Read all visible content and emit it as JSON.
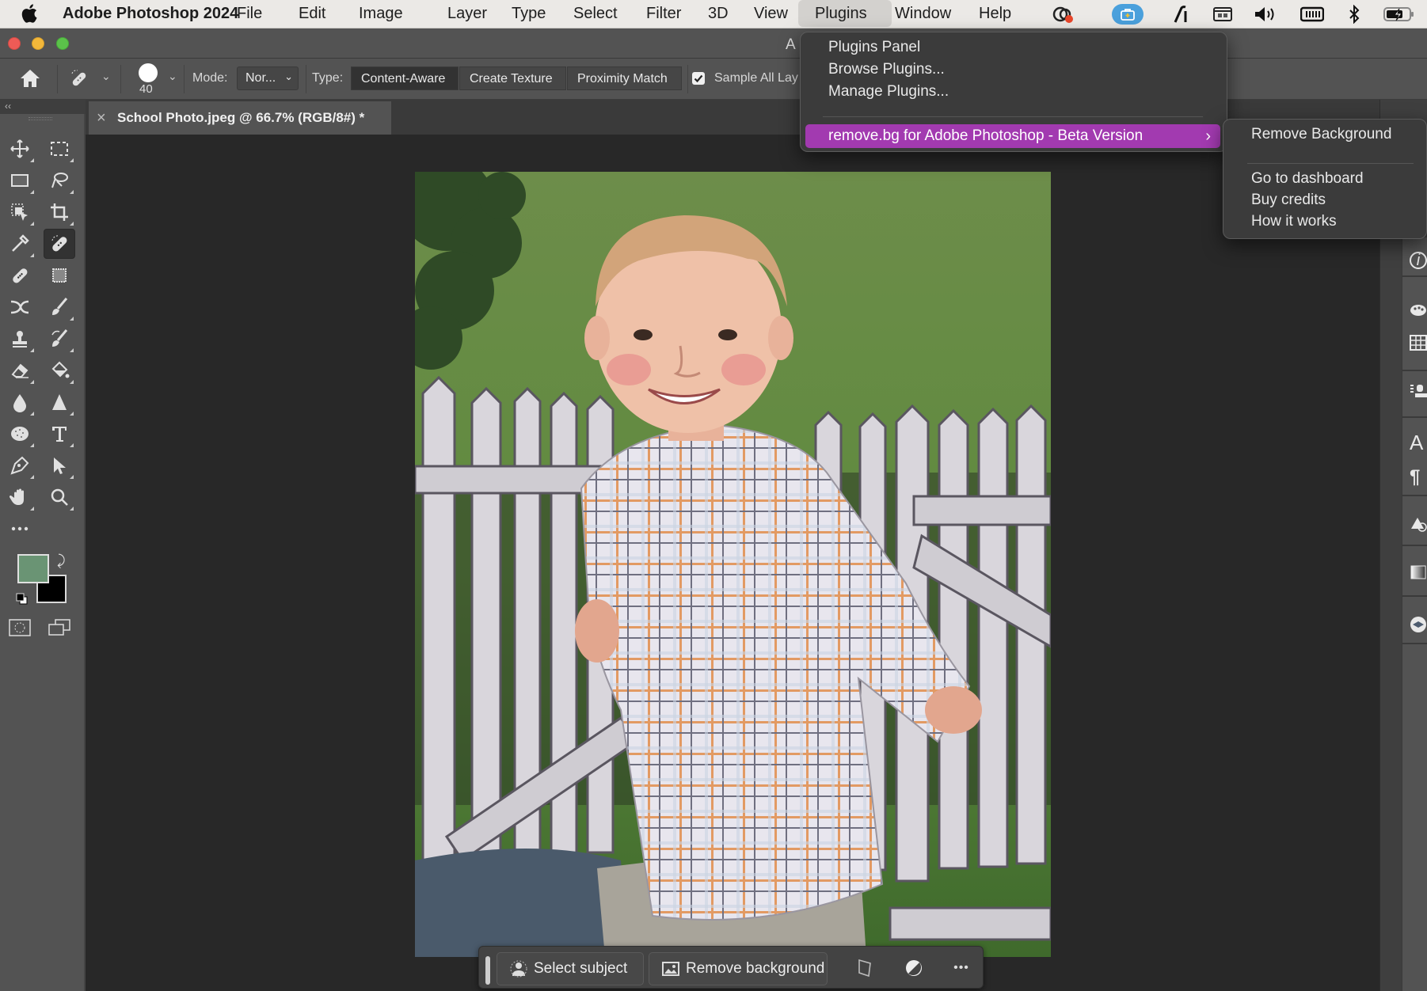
{
  "menubar": {
    "app_name": "Adobe Photoshop 2024",
    "items": [
      "File",
      "Edit",
      "Image",
      "Layer",
      "Type",
      "Select",
      "Filter",
      "3D",
      "View",
      "Plugins",
      "Window",
      "Help"
    ],
    "active_item": "Plugins",
    "tray_icons": [
      "creative-cloud-icon",
      "toolbox-app-icon",
      "pen-app-icon",
      "screen-capture-icon",
      "volume-icon",
      "keyboard-icon",
      "bluetooth-icon",
      "battery-charging-icon"
    ]
  },
  "window": {
    "title_partial": "A"
  },
  "options_bar": {
    "brush_size": "40",
    "mode_label": "Mode:",
    "mode_value": "Nor...",
    "type_label": "Type:",
    "type_options": [
      "Content-Aware",
      "Create Texture",
      "Proximity Match"
    ],
    "type_selected": "Content-Aware",
    "sample_all_layers_label": "Sample All Lay",
    "sample_all_layers_checked": true
  },
  "document_tab": {
    "title": "School Photo.jpeg @ 66.7% (RGB/8#) *",
    "close_glyph": "×"
  },
  "toolbar": {
    "collapse_glyph": "‹‹",
    "tools": [
      "move",
      "marquee",
      "object-frame",
      "lasso",
      "object-selection",
      "crop",
      "eyedropper",
      "spot-healing-brush",
      "healing-brush",
      "patch",
      "content-aware-move",
      "brush",
      "clone-stamp",
      "history-brush",
      "eraser",
      "paint-bucket",
      "blur",
      "sharpen",
      "sponge",
      "type",
      "pen",
      "path-selection",
      "hand",
      "zoom",
      "more-tools"
    ],
    "selected_tool": "spot-healing-brush",
    "more_glyph": "•••",
    "foreground_color": "#6a9474",
    "background_color": "#000000"
  },
  "plugins_menu": {
    "items": [
      "Plugins Panel",
      "Browse Plugins...",
      "Manage Plugins..."
    ],
    "highlighted": "remove.bg for Adobe Photoshop - Beta Version",
    "highlight_color": "#a23ab0",
    "chevron": "›"
  },
  "submenu": {
    "items_top": [
      "Remove Background"
    ],
    "items_bottom": [
      "Go to dashboard",
      "Buy credits",
      "How it works"
    ]
  },
  "taskbar": {
    "select_subject": "Select subject",
    "remove_background": "Remove background",
    "more_glyph": "•••"
  },
  "right_panel_icons": [
    "info-icon",
    "color-palette-icon",
    "swatches-grid-icon",
    "layer-comps-icon",
    "character-icon",
    "paragraph-icon",
    "shapes-icon",
    "gradient-icon",
    "layers-icon"
  ],
  "photo": {
    "description": "School photo of smiling toddler in plaid shirt in front of white picket fence with green grass backdrop"
  }
}
